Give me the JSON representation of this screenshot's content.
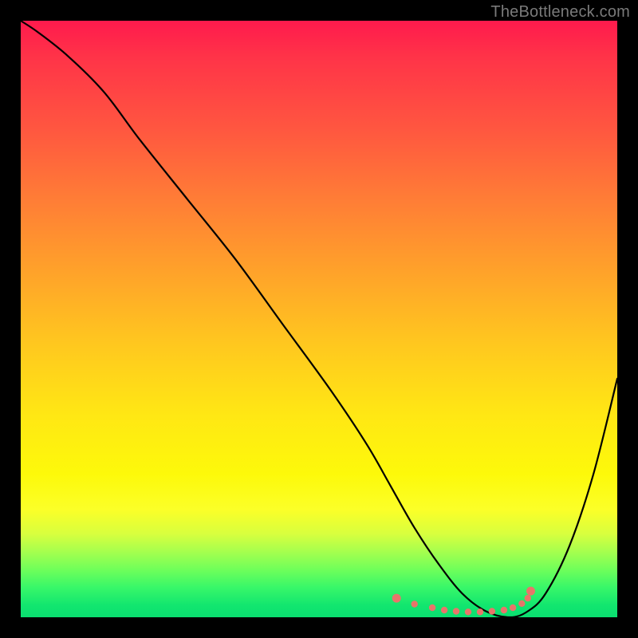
{
  "watermark": "TheBottleneck.com",
  "colors": {
    "frame": "#000000",
    "gradient_top": "#ff1a4d",
    "gradient_bottom": "#0adf70",
    "curve": "#000000",
    "dots": "#e8756a"
  },
  "chart_data": {
    "type": "line",
    "title": "",
    "xlabel": "",
    "ylabel": "",
    "xlim": [
      0,
      100
    ],
    "ylim": [
      0,
      100
    ],
    "series": [
      {
        "name": "bottleneck-curve",
        "x": [
          0,
          3,
          8,
          14,
          20,
          28,
          36,
          44,
          52,
          58,
          62,
          66,
          70,
          74,
          78,
          82,
          85,
          88,
          92,
          96,
          100
        ],
        "y": [
          100,
          98,
          94,
          88,
          80,
          70,
          60,
          49,
          38,
          29,
          22,
          15,
          9,
          4,
          1,
          0,
          1,
          4,
          12,
          24,
          40
        ]
      }
    ],
    "marker_cluster": {
      "name": "optimal-range-dots",
      "x": [
        63,
        66,
        69,
        71,
        73,
        75,
        77,
        79,
        81,
        82.5,
        84,
        85,
        85.5
      ],
      "y": [
        3.2,
        2.2,
        1.6,
        1.2,
        1.0,
        0.9,
        0.9,
        1.0,
        1.2,
        1.6,
        2.3,
        3.2,
        4.4
      ]
    }
  }
}
